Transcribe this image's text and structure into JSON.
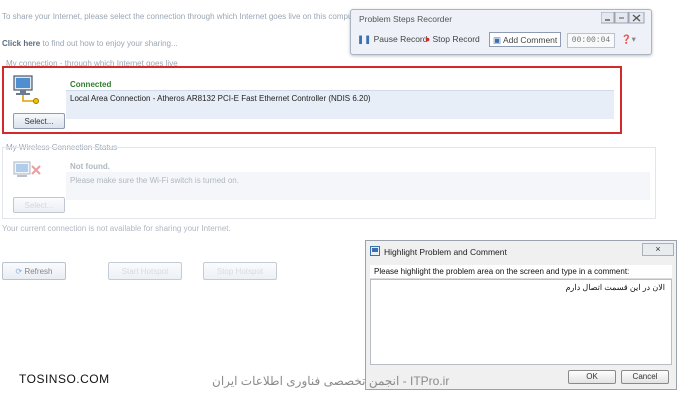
{
  "background_app": {
    "intro_text": "To share your Internet, please select the connection through which Internet goes live on this computer.",
    "click_here": "Click here",
    "click_here_rest": "to find out how to enjoy your sharing...",
    "wired_section_label": "My connection - through which Internet goes live",
    "wired": {
      "status": "Connected",
      "name": "Local Area Connection - Atheros AR8132 PCI-E Fast Ethernet Controller (NDIS 6.20)",
      "select_label": "Select..."
    },
    "wireless_section_label": "My Wireless Connection Status",
    "wireless": {
      "status": "Not found.",
      "hint": "Please make sure the Wi-Fi switch is turned on.",
      "select_label": "Select..."
    },
    "unavailable_note": "Your current connection is not available for sharing your Internet.",
    "buttons": {
      "refresh": "Refresh",
      "start_hotspot": "Start Hotspot",
      "stop_hotspot": "Stop Hotspot"
    }
  },
  "psr": {
    "title": "Problem Steps Recorder",
    "pause_label": "Pause Record",
    "stop_label": "Stop Record",
    "add_comment_label": "Add Comment",
    "timer": "00:00:04"
  },
  "dialog": {
    "title": "Highlight Problem and Comment",
    "prompt": "Please highlight the problem area on the screen and type in a comment:",
    "comment": "الان در این قسمت اتصال دارم",
    "ok_label": "OK",
    "cancel_label": "Cancel",
    "close_glyph": "×"
  },
  "watermark": {
    "left": "TOSINSO.COM",
    "right": "ITPro.ir - انجمن تخصصی فناوری اطلاعات ایران"
  },
  "colors": {
    "highlight_border": "#d22a2a",
    "connected_green": "#2f7d2f"
  }
}
